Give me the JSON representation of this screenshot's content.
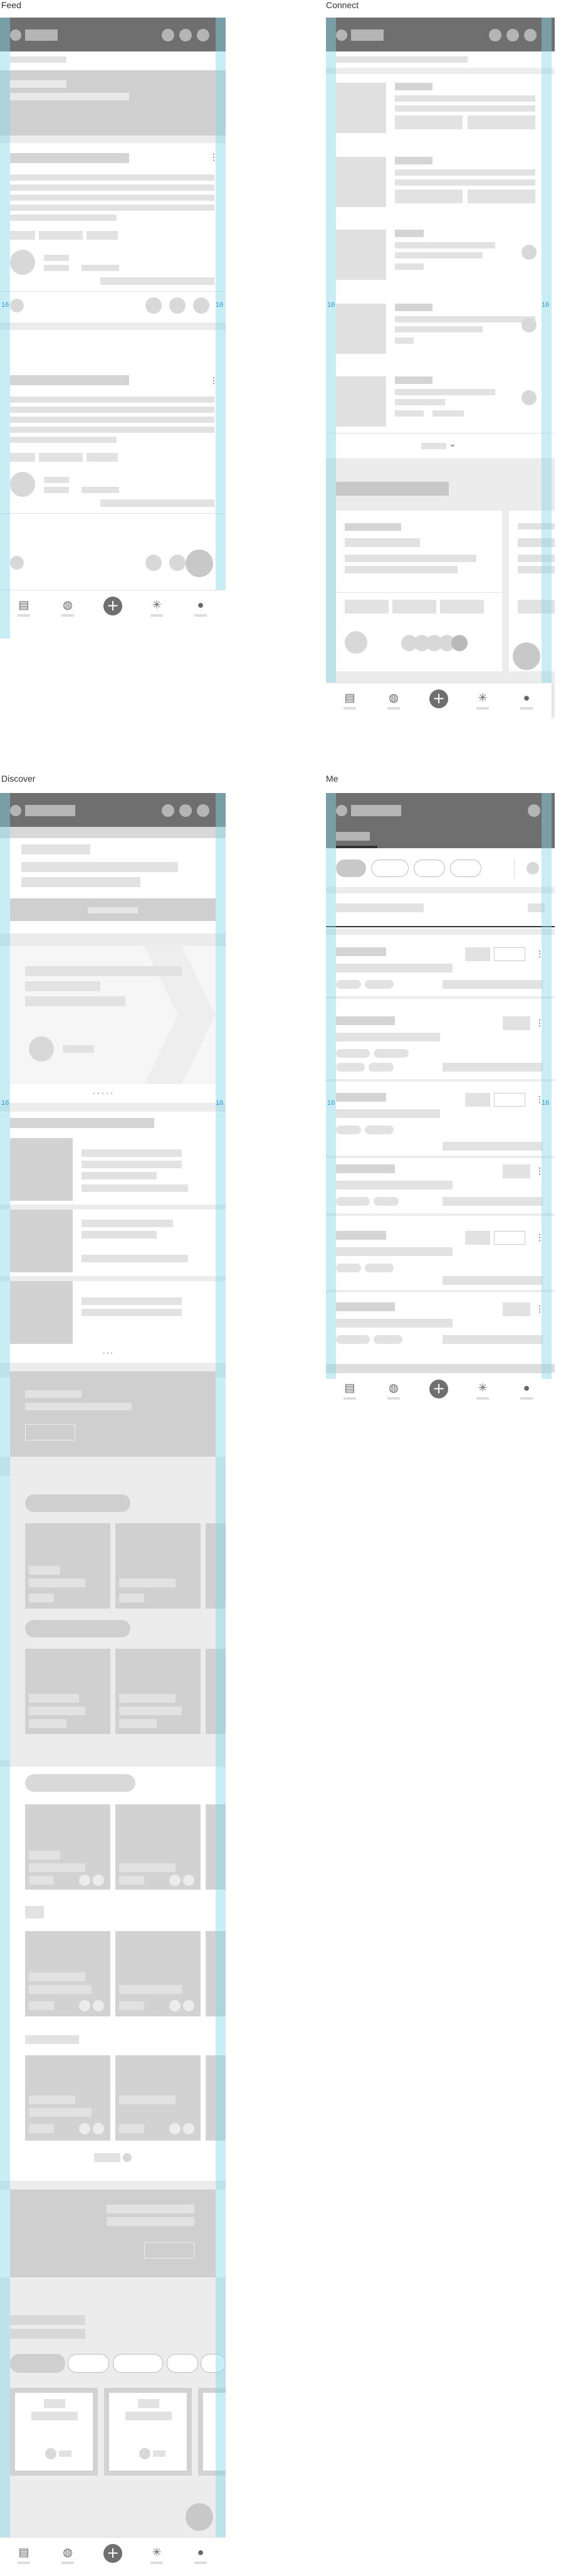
{
  "labels": {
    "feed": "Feed",
    "connect": "Connect",
    "discover": "Discover",
    "me": "Me"
  },
  "spacing": "16",
  "nav": {
    "news_icon": "▤",
    "globe_icon": "◍",
    "plus_icon": "+",
    "asterisk_icon": "✳",
    "person_icon": "●"
  },
  "connect": {
    "chevron": "⌄"
  },
  "kebab": "⋮",
  "colors": {
    "header": "#6f6f6f",
    "guide": "#85d6e8",
    "placeholder": "#e2e2e2"
  }
}
